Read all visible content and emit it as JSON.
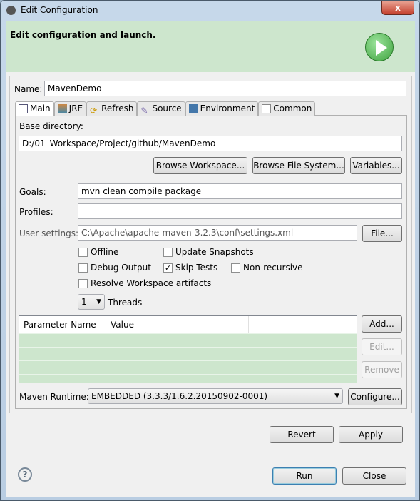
{
  "window": {
    "title": "Edit Configuration",
    "close_label": "x"
  },
  "banner": {
    "heading": "Edit configuration and launch."
  },
  "name": {
    "label": "Name:",
    "value": "MavenDemo"
  },
  "tabs": [
    {
      "label": "Main"
    },
    {
      "label": "JRE"
    },
    {
      "label": "Refresh"
    },
    {
      "label": "Source"
    },
    {
      "label": "Environment"
    },
    {
      "label": "Common"
    }
  ],
  "main": {
    "base_dir_label": "Base directory:",
    "base_dir_value": "D:/01_Workspace/Project/github/MavenDemo",
    "browse_workspace": "Browse Workspace...",
    "browse_fs": "Browse File System...",
    "variables": "Variables...",
    "goals_label": "Goals:",
    "goals_value": "mvn clean compile package",
    "profiles_label": "Profiles:",
    "profiles_value": "",
    "user_settings_label": "User settings:",
    "user_settings_value": "C:\\Apache\\apache-maven-3.2.3\\conf\\settings.xml",
    "file_button": "File...",
    "checkboxes": [
      {
        "label": "Offline",
        "checked": false
      },
      {
        "label": "Update Snapshots",
        "checked": false
      },
      {
        "label": "Debug Output",
        "checked": false
      },
      {
        "label": "Skip Tests",
        "checked": true
      },
      {
        "label": "Non-recursive",
        "checked": false
      },
      {
        "label": "Resolve Workspace artifacts",
        "checked": false
      }
    ],
    "threads_value": "1",
    "threads_label": "Threads",
    "table_headers": [
      "Parameter Name",
      "Value"
    ],
    "add": "Add...",
    "edit": "Edit...",
    "remove": "Remove",
    "runtime_label": "Maven Runtime:",
    "runtime_value": "EMBEDDED (3.3.3/1.6.2.20150902-0001)",
    "configure": "Configure..."
  },
  "footer": {
    "revert": "Revert",
    "apply": "Apply",
    "run": "Run",
    "close": "Close"
  },
  "colors": {
    "banner": "#cde6cd",
    "run_icon": "#3fa33f"
  }
}
